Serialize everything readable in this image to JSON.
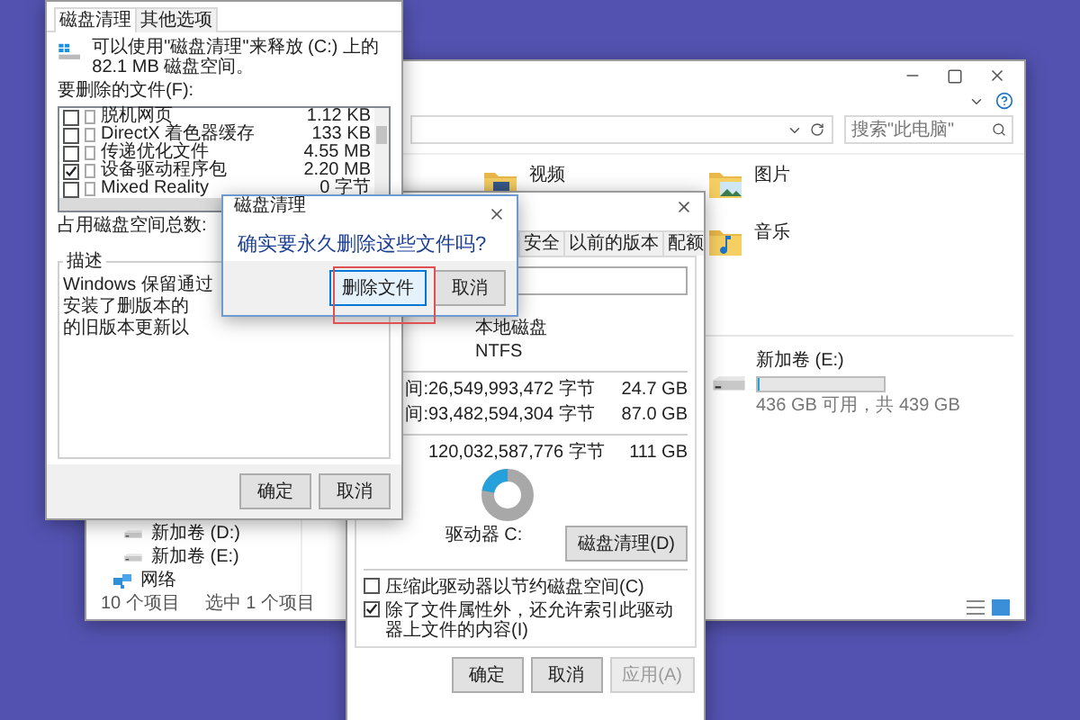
{
  "explorer": {
    "search": {
      "placeholder": "搜索\"此电脑\""
    },
    "folders": [
      {
        "name": "视频"
      },
      {
        "name": "图片"
      },
      {
        "name": "音乐"
      }
    ],
    "drive": {
      "name": "新加卷 (E:)",
      "level": 0.01,
      "free": "436 GB 可用，共 439 GB"
    },
    "nav": [
      {
        "label": "新加卷 (D:)",
        "kind": "drive"
      },
      {
        "label": "新加卷 (E:)",
        "kind": "drive"
      },
      {
        "label": "网络",
        "kind": "network"
      }
    ],
    "status": [
      "10 个项目",
      "选中 1 个项目"
    ]
  },
  "properties": {
    "tabs": [
      "安全",
      "以前的版本",
      "配额"
    ],
    "type": "本地磁盘",
    "fs": "NTFS",
    "rows": [
      {
        "label": "间:",
        "bytes": "26,549,993,472 字节",
        "size": "24.7 GB"
      },
      {
        "label": "间:",
        "bytes": "93,482,594,304 字节",
        "size": "87.0 GB"
      },
      {
        "label": "",
        "bytes": "120,032,587,776 字节",
        "size": "111 GB"
      }
    ],
    "drive": "驱动器 C:",
    "clean_button": "磁盘清理(D)",
    "options": [
      {
        "label": "压缩此驱动器以节约磁盘空间(C)",
        "checked": false
      },
      {
        "label": "除了文件属性外，还允许索引此驱动器上文件的内容(I)",
        "checked": true
      }
    ],
    "buttons": [
      {
        "label": "确定",
        "disabled": false
      },
      {
        "label": "取消",
        "disabled": false
      },
      {
        "label": "应用(A)",
        "disabled": true
      }
    ]
  },
  "cleanup": {
    "tabs": [
      {
        "label": "磁盘清理",
        "selected": true
      },
      {
        "label": "其他选项",
        "selected": false
      }
    ],
    "summary": "可以使用\"磁盘清理\"来释放 (C:) 上的 82.1 MB 磁盘空间。",
    "files_label": "要删除的文件(F):",
    "files": [
      {
        "name": "脱机网页",
        "size": "1.12 KB",
        "checked": false
      },
      {
        "name": "DirectX 着色器缓存",
        "size": "133 KB",
        "checked": false
      },
      {
        "name": "传递优化文件",
        "size": "4.55 MB",
        "checked": false
      },
      {
        "name": "设备驱动程序包",
        "size": "2.20 MB",
        "checked": true
      },
      {
        "name": "Mixed Reality",
        "size": "0 字节",
        "checked": false
      }
    ],
    "total_label": "占用磁盘空间总数:",
    "description_title": "描述",
    "description_lines": [
      "Windows 保留通过",
      "安装了删版本的",
      "的旧版本更新以"
    ],
    "buttons": [
      "确定",
      "取消"
    ]
  },
  "dialog": {
    "title": "磁盘清理",
    "message": "确实要永久删除这些文件吗?",
    "buttons": [
      {
        "label": "删除文件",
        "selected": true
      },
      {
        "label": "取消",
        "selected": false
      }
    ]
  }
}
